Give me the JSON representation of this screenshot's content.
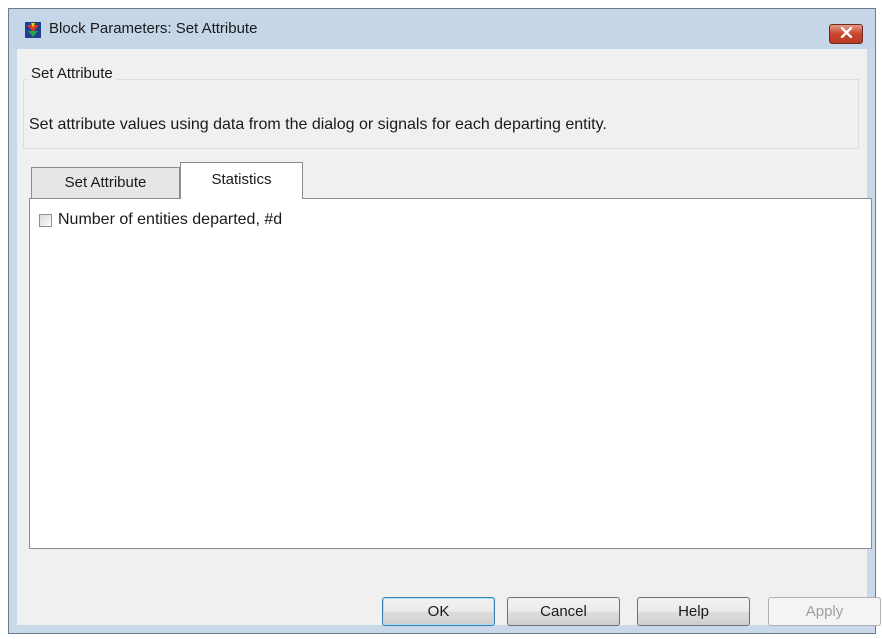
{
  "window": {
    "title": "Block Parameters: Set Attribute",
    "app_icon": "simulink-icon",
    "close_icon": "close-icon"
  },
  "group": {
    "title": "Set Attribute",
    "description": "Set attribute values using data from the dialog or signals for each departing entity."
  },
  "tabs": [
    {
      "label": "Set Attribute",
      "selected": false
    },
    {
      "label": "Statistics",
      "selected": true
    }
  ],
  "statistics": {
    "checkbox_label": "Number of entities departed, #d",
    "checked": false
  },
  "buttons": {
    "ok": "OK",
    "cancel": "Cancel",
    "help": "Help",
    "apply": "Apply"
  },
  "colors": {
    "close_button": "#c8452c",
    "titlebar": "#c5d6e9",
    "dialog_bg": "#f0f0f0"
  }
}
